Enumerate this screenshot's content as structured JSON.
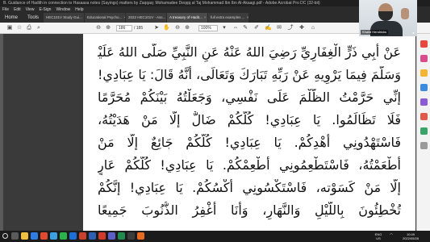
{
  "window": {
    "title": "B. Guidance of Hadith in connection to Hasaasa notes (Sayings) matters by Zaqqaq: Mohamadee Deqqq al Taj Mohammad Ibn Ibn Al-Akaagi.pdf - Adobe Acrobat Pro DC (32-bit)"
  },
  "menu": [
    "File",
    "Edit",
    "View",
    "E-Sign",
    "Window",
    "Help"
  ],
  "nav_tabs": [
    "Home",
    "Tools"
  ],
  "doc_tabs": [
    {
      "label": "HEC101V Study Gui...",
      "active": false
    },
    {
      "label": "Educational Psycho...",
      "active": false
    },
    {
      "label": "2022 HEC101V - Ass...",
      "active": false
    },
    {
      "label": "A treasury of Hadit...",
      "active": true
    },
    {
      "label": "full extra examples ...",
      "active": false
    }
  ],
  "toolbar": {
    "page_current": "186",
    "page_total": "/ 185",
    "zoom": "100%"
  },
  "document": {
    "lines": [
      "عَنْ أَبِي ذَرٍّ الْغِفَارِيِّ رَضِيَ اللهُ عَنْهُ عَنِ النَّبِيِّ صَلَّى اللهُ عَلَيْهِ",
      "وَسَلَّمَ فِيمَا يَرْوِيهِ عَنْ رَبِّهِ تَبَارَكَ وَتَعَالَى، أَنَّهُ قَالَ: يَا عِبَادِي!",
      "إنِّي حَرَّمْتُ الظُّلْمَ عَلَى نَفْسِي، وَجَعَلْتُهُ بَيْنَكُمْ مُحَرَّمًا",
      "فَلَا تَظَالَمُوا. يَا عِبَادِي! كُلُّكُمْ ضَالٌّ إلَّا مَنْ هَدَيْتُهُ،",
      "فَاسْتَهْدُونِي أَهْدِكُمْ. يَا عِبَادِي! كُلُّكُمْ جَائِعٌ إلَّا مَنْ",
      "أَطْعَمْتُهُ، فَاسْتَطْعِمُونِي أُطْعِمْكُمْ. يَا عِبَادِي! كُلُّكُمْ عَارٍ",
      "إلَّا مَنْ كَسَوْته، فَاسْتَكْسُونِي أَكْسُكُمْ. يَا عِبَادِي! إنَّكُمْ",
      "تُخْطِئُونَ بِاللَّيْلِ وَالنَّهَارِ، وَأَنَا أَغْفِرُ الذُّنُوبَ جَمِيعًا"
    ]
  },
  "video_overlay": {
    "participant_name": "Khalid Hendricks"
  },
  "taskbar": {
    "lang": "ENG",
    "region": "US",
    "time": "10:49",
    "date": "2022/05/28"
  }
}
